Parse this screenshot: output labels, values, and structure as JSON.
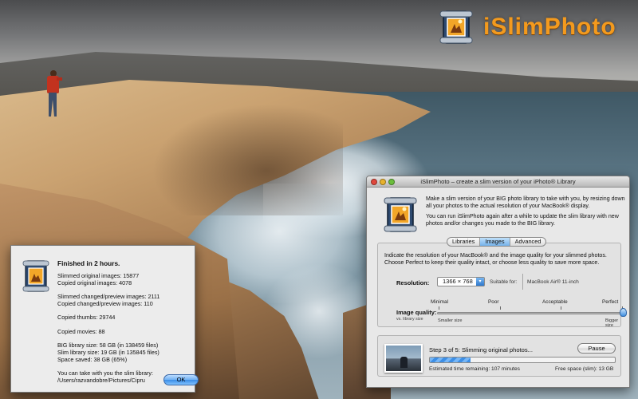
{
  "logo": {
    "text": "iSlimPhoto",
    "icon": "islimphoto-app-icon",
    "color": "#f39a1e"
  },
  "background": {
    "description_icon": "coastal-cliff-photo"
  },
  "finished_dialog": {
    "title": "Finished in 2 hours.",
    "lines": {
      "slimmed": "Slimmed original images: 15877",
      "copied": "Copied original images: 4078",
      "slimmed_changed": "Slimmed changed/preview images: 2111",
      "copied_changed": "Copied changed/preview images: 110",
      "thumbs": "Copied thumbs: 29744",
      "movies": "Copied movies: 88",
      "big_size": "BIG library size: 58 GB (in 138459 files)",
      "slim_size": "Slim library size: 19 GB (in 135845 files)",
      "saved": "Space saved: 38 GB (65%)",
      "take_with": "You can take with you the slim library:",
      "path": "/Users/razvandobre/Pictures/Cipru"
    },
    "ok_label": "OK"
  },
  "main_window": {
    "title": "iSlimPhoto – create a slim version of your iPhoto® Library",
    "intro_1": "Make a slim version of your BIG photo library to take with you, by resizing down all your photos to the actual resolution of your MacBook® display.",
    "intro_2": "You can run iSlimPhoto again after a while to update the slim library with new photos and/or changes you made to the BIG library.",
    "tabs": [
      {
        "label": "Libraries",
        "active": false
      },
      {
        "label": "Images",
        "active": true
      },
      {
        "label": "Advanced",
        "active": false
      }
    ],
    "images_panel": {
      "description": "Indicate the resolution of your MacBook® and the image quality for your slimmed photos. Choose Perfect to keep their quality intact, or choose less quality to save more space.",
      "resolution_label": "Resolution:",
      "resolution_value": "1366 × 768",
      "suitable_for_label": "Suitable for:",
      "device": "MacBook Air® 11-inch",
      "quality_levels": [
        "Minimal",
        "Poor",
        "Acceptable",
        "Perfect"
      ],
      "quality_label": "Image quality:",
      "quality_sub": "vs. library size",
      "smaller_label": "Smaller size",
      "bigger_label": "Bigger size",
      "quality_selected": "Perfect"
    },
    "progress": {
      "step_text": "Step 3 of 5: Slimming original photos...",
      "pause_label": "Pause",
      "percent": 22,
      "eta_text": "Estimated time remaining: 107 minutes",
      "free_space_text": "Free space (slim):     13 GB"
    }
  },
  "colors": {
    "accent_blue": "#3b8ce6",
    "window_bg": "#e8e8e8"
  }
}
